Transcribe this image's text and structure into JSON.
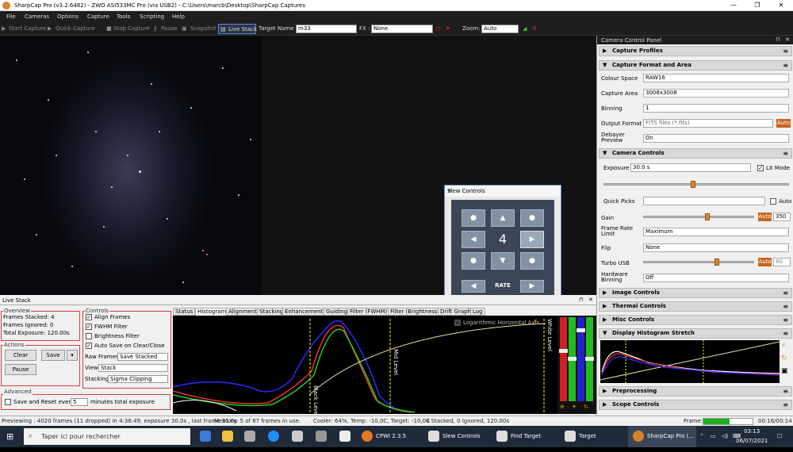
{
  "window": {
    "title": "SharpCap Pro (v3.2.6482) - ZWO ASI533MC Pro (via USB2) - C:\\Users\\marcb\\Desktop\\SharpCap Captures",
    "minimize": "—",
    "maximize": "❐",
    "close": "✕"
  },
  "menu": [
    "File",
    "Cameras",
    "Options",
    "Capture",
    "Tools",
    "Scripting",
    "Help"
  ],
  "toolbar": {
    "start_capture": "Start Capture",
    "quick_capture": "Quick Capture",
    "stop_capture": "Stop Capture",
    "pause": "Pause",
    "snapshot": "Snapshot",
    "live_stack": "Live Stack",
    "target_label": "Target Name :",
    "target_value": "m33",
    "fx_label": "FX :",
    "fx_value": "None",
    "zoom_label": "Zoom:",
    "zoom_value": "Auto"
  },
  "slew": {
    "title": "Slew Controls",
    "close": "✕",
    "rate_value": "4",
    "rate_label": "RATE",
    "up": "▲",
    "down": "▼",
    "left": "◀",
    "right": "▶",
    "dot": "●"
  },
  "livestack": {
    "title": "Live Stack",
    "overview_title": "Overview",
    "frames_stacked": "Frames Stacked: 4",
    "frames_ignored": "Frames Ignored:  0",
    "total_exposure": "Total Exposure:   120.00s",
    "actions_title": "Actions",
    "clear": "Clear",
    "save": "Save",
    "pause": "Pause",
    "advanced_title": "Advanced",
    "save_reset_label": "Save and Reset every",
    "save_reset_value": "5",
    "save_reset_suffix": "minutes total exposure",
    "controls_title": "Controls",
    "align_frames": "Align Frames",
    "fwhm_filter": "FWHM Filter",
    "brightness_filter": "Brightness Filter",
    "auto_save": "Auto Save on Clear/Close",
    "raw_frames_label": "Raw Frames",
    "raw_frames_value": "Save Stacked",
    "view_label": "View",
    "view_value": "Stack",
    "stacking_label": "Stacking",
    "stacking_value": "Sigma Clipping",
    "check": "✓"
  },
  "tabs": [
    "Status",
    "Histogram",
    "Alignment",
    "Stacking",
    "Enhancement",
    "Guiding",
    "Filter (FWHM)",
    "Filter (Brightness)",
    "Drift Graph",
    "Log"
  ],
  "histogram": {
    "log_axis": "Logarithmic Horizontal Axis",
    "black_level": "Black Level",
    "mid_level": "Mid Level",
    "white_level": "White Level"
  },
  "status": {
    "previewing": "Previewing : 4020 frames (11 dropped) in 4:36:49, exposure 30.0s , last frame 31.0s",
    "memory": "Memory: 5 of 87 frames in use.",
    "cooler": "Cooler: 64%, Temp: -10,0C, Target: -10,0C",
    "stacked": "4 Stacked, 0 Ignored, 120.00s",
    "frame_label": "Frame:",
    "frame_time": "00:16/00:14"
  },
  "panel": {
    "title": "Camera Control Panel",
    "pin": "⊓",
    "close": "✕",
    "chev_right": "▶",
    "chev_down": "▼",
    "ham": "≡",
    "capture_profiles": "Capture Profiles",
    "capture_format": "Capture Format and Area",
    "colour_space_label": "Colour Space",
    "colour_space_value": "RAW16",
    "capture_area_label": "Capture Area",
    "capture_area_value": "3008x3008",
    "binning_label": "Binning",
    "binning_value": "1",
    "output_format_label": "Output Format",
    "output_format_value": "FITS files (*.fits)",
    "auto": "Auto",
    "debayer_label": "Debayer Preview",
    "debayer_value": "On",
    "camera_controls": "Camera Controls",
    "exposure_label": "Exposure",
    "exposure_value": "30.0 s",
    "lx_mode": "LX Mode",
    "quick_picks_label": "Quick Picks",
    "gain_label": "Gain",
    "gain_value": "350",
    "frame_rate_label": "Frame Rate Limit",
    "frame_rate_value": "Maximum",
    "flip_label": "Flip",
    "flip_value": "None",
    "turbo_label": "Turbo USB",
    "turbo_value": "80",
    "hw_binning_label": "Hardware Binning",
    "hw_binning_value": "Off",
    "image_controls": "Image Controls",
    "thermal_controls": "Thermal Controls",
    "misc_controls": "Misc Controls",
    "display_histogram": "Display Histogram Stretch",
    "preprocessing": "Preprocessing",
    "scope_controls": "Scope Controls"
  },
  "taskbar": {
    "search": "Taper ici pour rechercher",
    "apps": [
      "CPWI 2.3.5",
      "Slew Controls",
      "Find Target",
      "Target",
      "SharpCap Pro (..."
    ],
    "time": "03:13",
    "date": "06/07/2021"
  }
}
